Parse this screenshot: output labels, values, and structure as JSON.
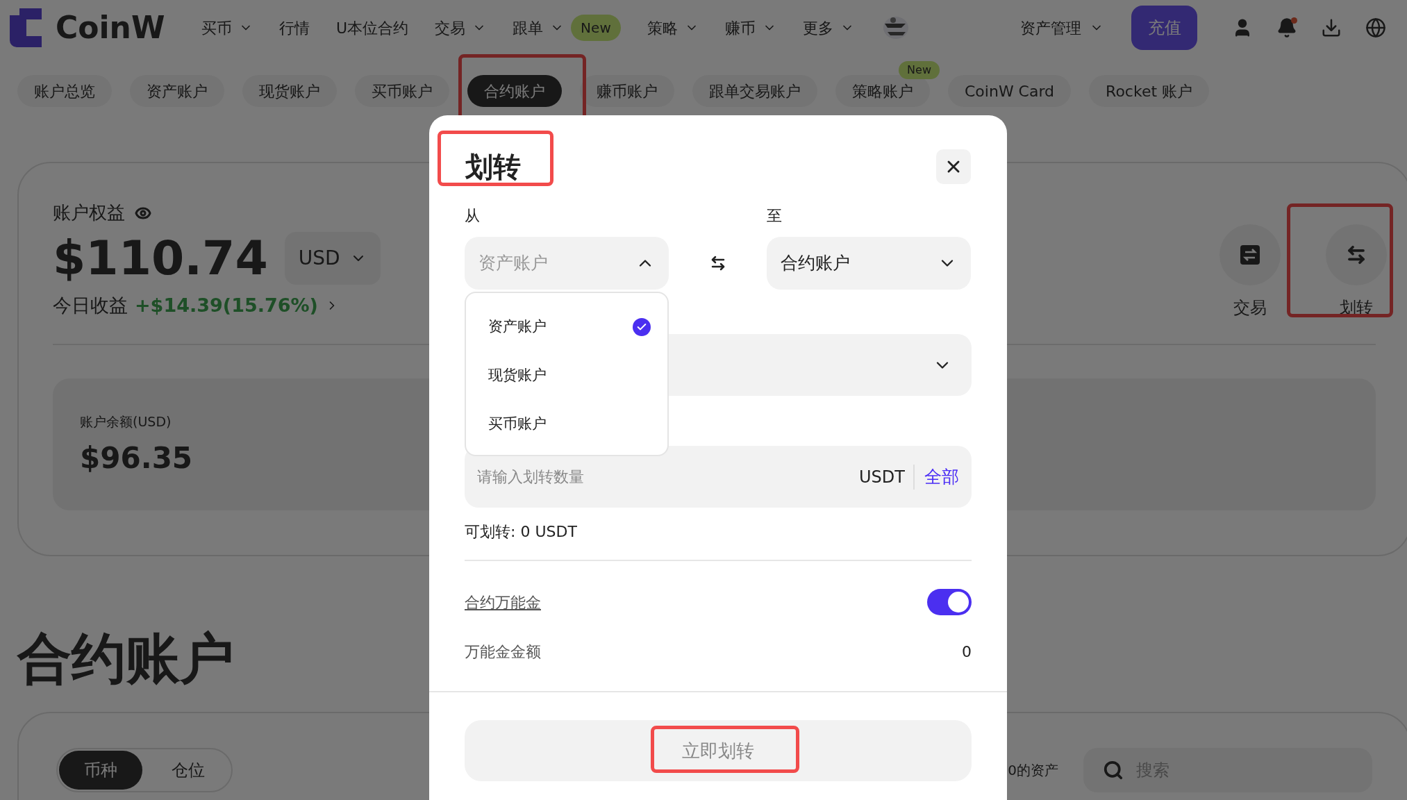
{
  "nav": {
    "logo": "CoinW",
    "items": [
      {
        "label": "买币",
        "dropdown": true
      },
      {
        "label": "行情",
        "dropdown": false
      },
      {
        "label": "U本位合约",
        "dropdown": false
      },
      {
        "label": "交易",
        "dropdown": true
      },
      {
        "label": "跟单",
        "dropdown": true,
        "badge": "New"
      },
      {
        "label": "策略",
        "dropdown": true
      },
      {
        "label": "赚币",
        "dropdown": true
      },
      {
        "label": "更多",
        "dropdown": true
      }
    ],
    "asset_menu": "资产管理",
    "deposit_button": "充值"
  },
  "account_tabs": [
    {
      "label": "账户总览",
      "selected": false
    },
    {
      "label": "资产账户",
      "selected": false
    },
    {
      "label": "现货账户",
      "selected": false
    },
    {
      "label": "买币账户",
      "selected": false
    },
    {
      "label": "合约账户",
      "selected": true
    },
    {
      "label": "赚币账户",
      "selected": false
    },
    {
      "label": "跟单交易账户",
      "selected": false
    },
    {
      "label": "策略账户",
      "selected": false,
      "badge": "New"
    },
    {
      "label": "CoinW Card",
      "selected": false
    },
    {
      "label": "Rocket 账户",
      "selected": false
    }
  ],
  "equity": {
    "label": "账户权益",
    "amount": "$110.74",
    "currency": "USD",
    "today_label": "今日收益",
    "today_value": "+$14.39(15.76%)",
    "balance_label": "账户余额(USD)",
    "balance": "$96.35"
  },
  "actions": [
    {
      "label": "交易",
      "kind": "trade"
    },
    {
      "label": "划转",
      "kind": "transfer"
    }
  ],
  "heading": "合约账户",
  "asset_tabs": [
    {
      "label": "币种",
      "selected": true
    },
    {
      "label": "仓位",
      "selected": false
    }
  ],
  "hide_zero_label": "0的资产",
  "search": {
    "placeholder": "搜索"
  },
  "dialog": {
    "title": "划转",
    "from_label": "从",
    "to_label": "至",
    "from": {
      "value": "资产账户",
      "expanded": true
    },
    "to": {
      "value": "合约账户",
      "expanded": false
    },
    "from_options": [
      {
        "label": "资产账户",
        "selected": true
      },
      {
        "label": "现货账户",
        "selected": false
      },
      {
        "label": "买币账户",
        "selected": false
      }
    ],
    "amount": {
      "placeholder": "请输入划转数量",
      "unit": "USDT",
      "max_button": "全部"
    },
    "available": "可划转: 0 USDT",
    "bonus": {
      "label": "合约万能金",
      "on": true
    },
    "bonus_amount": {
      "label": "万能金金额",
      "value": "0"
    },
    "submit": "立即划转"
  }
}
